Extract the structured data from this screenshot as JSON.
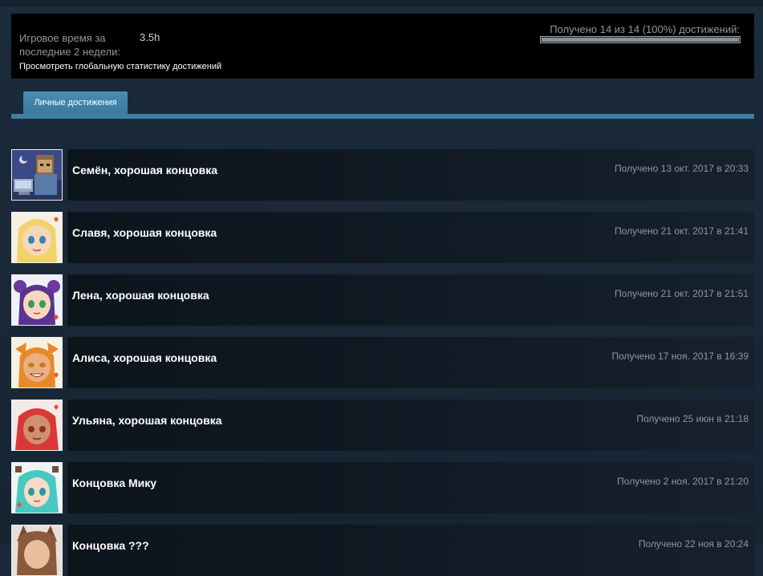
{
  "stats": {
    "playtime_label": "Игровое время за последние 2 недели:",
    "playtime_value": "3.5h",
    "global_link": "Просмотреть глобальную статистику достижений",
    "progress_text": "Получено 14 из 14 (100%) достижений:",
    "progress_fraction": 1.0
  },
  "tabs": [
    {
      "label": "Личные достижения"
    }
  ],
  "achievements": [
    {
      "title": "Семён, хорошая концовка",
      "date": "Получено 13 окт. 2017 в 20:33",
      "icon": "semyon-portrait-icon"
    },
    {
      "title": "Славя, хорошая концовка",
      "date": "Получено 21 окт. 2017 в 21:41",
      "icon": "slavya-portrait-icon"
    },
    {
      "title": "Лена, хорошая концовка",
      "date": "Получено 21 окт. 2017 в 21:51",
      "icon": "lena-portrait-icon"
    },
    {
      "title": "Алиса, хорошая концовка",
      "date": "Получено 17 ноя. 2017 в 16:39",
      "icon": "alisa-portrait-icon"
    },
    {
      "title": "Ульяна, хорошая концовка",
      "date": "Получено 25 июн в 21:18",
      "icon": "ulyana-portrait-icon"
    },
    {
      "title": "Концовка Мику",
      "date": "Получено 2 ноя. 2017 в 21:20",
      "icon": "miku-portrait-icon"
    },
    {
      "title": "Концовка ???",
      "date": "Получено 22 ноя в 20:24",
      "icon": "unknown-portrait-icon"
    }
  ],
  "colors": {
    "accent": "#3f7fa4",
    "background": "#1b2838",
    "row": "#0e1720"
  }
}
